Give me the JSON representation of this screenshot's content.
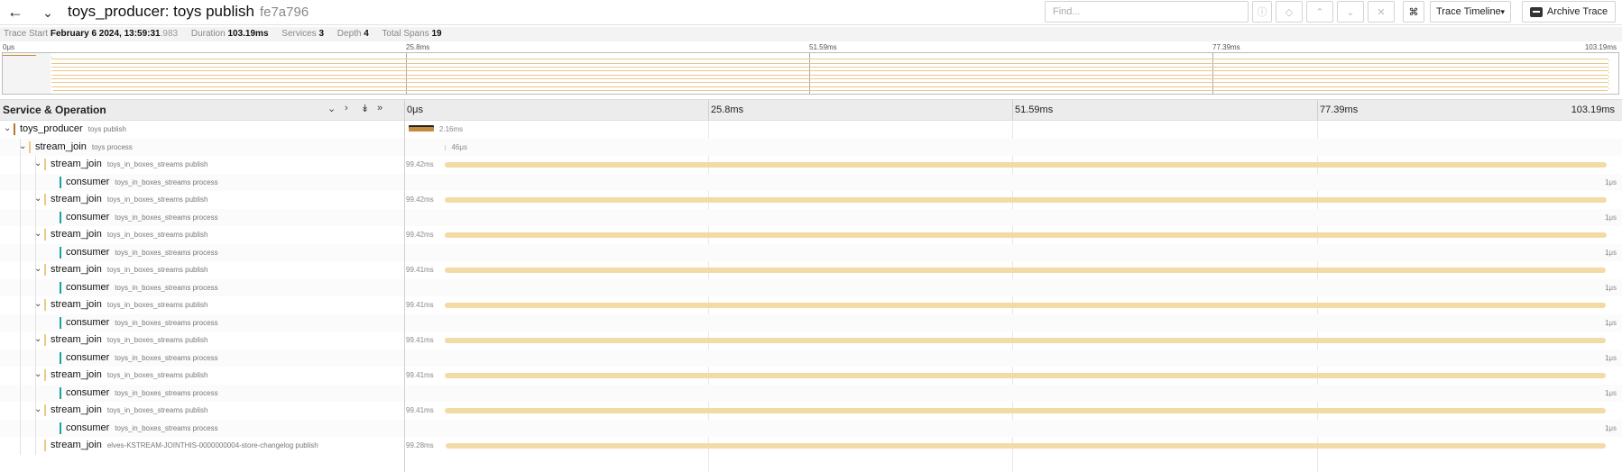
{
  "header": {
    "title": "toys_producer: toys publish",
    "trace_id": "fe7a796",
    "find_placeholder": "Find...",
    "view_select": "Trace Timeline",
    "archive_label": "Archive Trace"
  },
  "meta": {
    "trace_start_label": "Trace Start",
    "trace_start_value": "February 6 2024, 13:59:31",
    "trace_start_ms": ".983",
    "duration_label": "Duration",
    "duration_value": "103.19ms",
    "services_label": "Services",
    "services_value": "3",
    "depth_label": "Depth",
    "depth_value": "4",
    "spans_label": "Total Spans",
    "spans_value": "19"
  },
  "minimap_ticks": [
    "0μs",
    "25.8ms",
    "51.59ms",
    "77.39ms",
    "103.19ms"
  ],
  "timeline_header": {
    "service_label": "Service & Operation",
    "ticks": [
      "0μs",
      "25.8ms",
      "51.59ms",
      "77.39ms",
      "103.19ms"
    ]
  },
  "colors": {
    "toys_producer": "#b5762f",
    "stream_join": "#f1c785",
    "consumer": "#17a2a4",
    "bar_stream": "#f3dba6",
    "bar_root": "#c48a3e"
  },
  "spans": [
    {
      "level": 0,
      "service": "toys_producer",
      "op": "toys publish",
      "dur": "2.16ms",
      "start": 0.0,
      "width": 0.0209,
      "chev": "⌄"
    },
    {
      "level": 1,
      "service": "stream_join",
      "op": "toys process",
      "dur": "46μs",
      "start": 0.0303,
      "width": 0.0004,
      "chev": "⌄"
    },
    {
      "level": 2,
      "service": "stream_join",
      "op": "toys_in_boxes_streams publish",
      "dur": "99.42ms",
      "start": 0.0303,
      "width": 0.9634,
      "chev": "⌄"
    },
    {
      "level": 3,
      "service": "consumer",
      "op": "toys_in_boxes_streams process",
      "dur": "1μs",
      "start": 0.9938,
      "width": 0.0,
      "chev": ""
    },
    {
      "level": 2,
      "service": "stream_join",
      "op": "toys_in_boxes_streams publish",
      "dur": "99.42ms",
      "start": 0.0303,
      "width": 0.9634,
      "chev": "⌄"
    },
    {
      "level": 3,
      "service": "consumer",
      "op": "toys_in_boxes_streams process",
      "dur": "1μs",
      "start": 0.9938,
      "width": 0.0,
      "chev": ""
    },
    {
      "level": 2,
      "service": "stream_join",
      "op": "toys_in_boxes_streams publish",
      "dur": "99.42ms",
      "start": 0.0303,
      "width": 0.9634,
      "chev": "⌄"
    },
    {
      "level": 3,
      "service": "consumer",
      "op": "toys_in_boxes_streams process",
      "dur": "1μs",
      "start": 0.9938,
      "width": 0.0,
      "chev": ""
    },
    {
      "level": 2,
      "service": "stream_join",
      "op": "toys_in_boxes_streams publish",
      "dur": "99.41ms",
      "start": 0.0303,
      "width": 0.9633,
      "chev": "⌄"
    },
    {
      "level": 3,
      "service": "consumer",
      "op": "toys_in_boxes_streams process",
      "dur": "1μs",
      "start": 0.9938,
      "width": 0.0,
      "chev": ""
    },
    {
      "level": 2,
      "service": "stream_join",
      "op": "toys_in_boxes_streams publish",
      "dur": "99.41ms",
      "start": 0.0303,
      "width": 0.9633,
      "chev": "⌄"
    },
    {
      "level": 3,
      "service": "consumer",
      "op": "toys_in_boxes_streams process",
      "dur": "1μs",
      "start": 0.9938,
      "width": 0.0,
      "chev": ""
    },
    {
      "level": 2,
      "service": "stream_join",
      "op": "toys_in_boxes_streams publish",
      "dur": "99.41ms",
      "start": 0.0303,
      "width": 0.9633,
      "chev": "⌄"
    },
    {
      "level": 3,
      "service": "consumer",
      "op": "toys_in_boxes_streams process",
      "dur": "1μs",
      "start": 0.9938,
      "width": 0.0,
      "chev": ""
    },
    {
      "level": 2,
      "service": "stream_join",
      "op": "toys_in_boxes_streams publish",
      "dur": "99.41ms",
      "start": 0.0303,
      "width": 0.9633,
      "chev": "⌄"
    },
    {
      "level": 3,
      "service": "consumer",
      "op": "toys_in_boxes_streams process",
      "dur": "1μs",
      "start": 0.9938,
      "width": 0.0,
      "chev": ""
    },
    {
      "level": 2,
      "service": "stream_join",
      "op": "toys_in_boxes_streams publish",
      "dur": "99.41ms",
      "start": 0.0303,
      "width": 0.9633,
      "chev": "⌄"
    },
    {
      "level": 3,
      "service": "consumer",
      "op": "toys_in_boxes_streams process",
      "dur": "1μs",
      "start": 0.9938,
      "width": 0.0,
      "chev": ""
    },
    {
      "level": 2,
      "service": "stream_join",
      "op": "elves-KSTREAM-JOINTHIS-0000000004-store-changelog publish",
      "dur": "99.28ms",
      "start": 0.031,
      "width": 0.9621,
      "chev": ""
    }
  ]
}
